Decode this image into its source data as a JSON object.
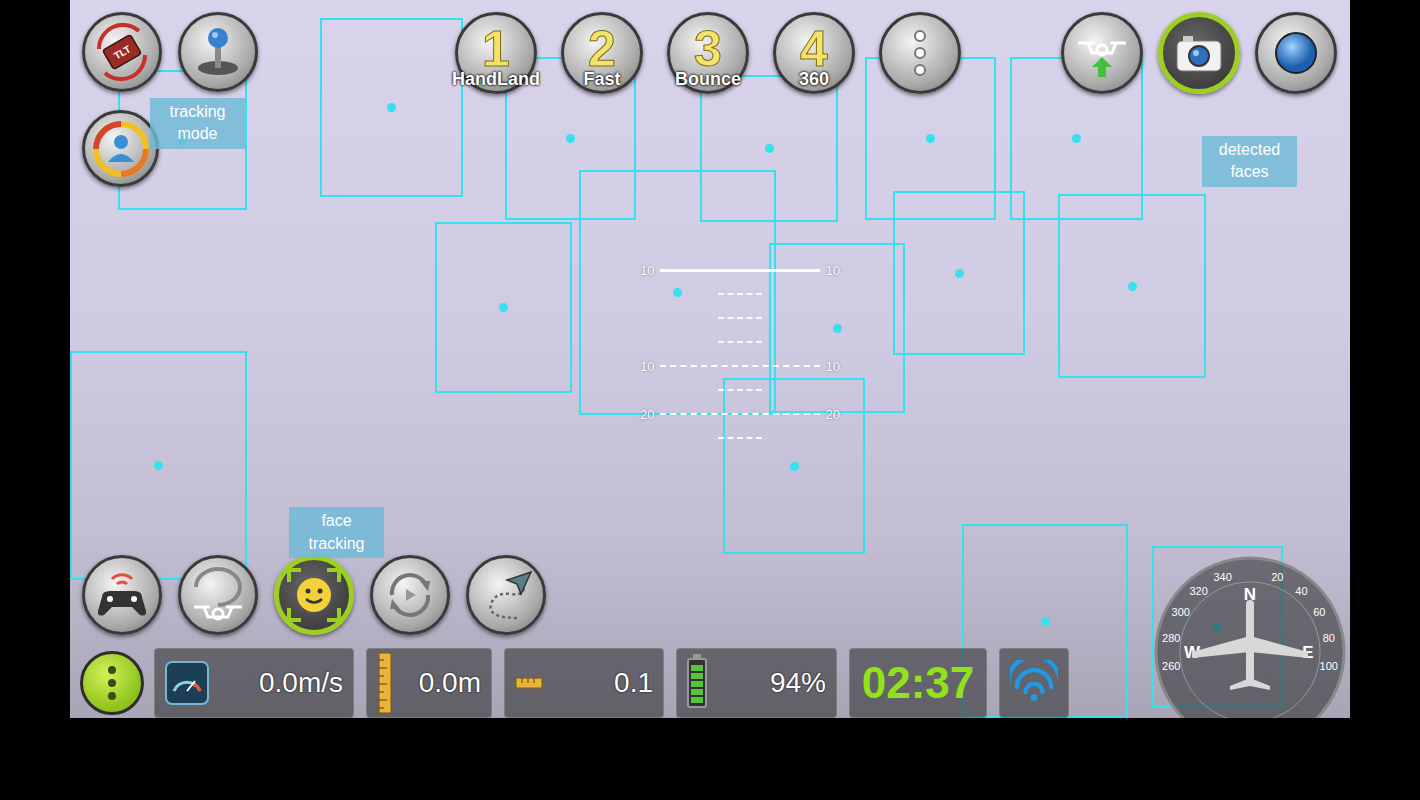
{
  "tilt_button": {
    "label": "TLT",
    "selected": false
  },
  "joystick_button": {
    "selected": false
  },
  "tracking_mode_button": {
    "selected": false
  },
  "callouts": [
    {
      "kind": "tracking-mode",
      "text": "tracking mode"
    },
    {
      "kind": "detected-faces",
      "text": "detected faces"
    },
    {
      "kind": "face-tracking",
      "text": "face tracking"
    }
  ],
  "flip_buttons": [
    {
      "number": "1",
      "label": "HandLand"
    },
    {
      "number": "2",
      "label": "Fast"
    },
    {
      "number": "3",
      "label": "Bounce"
    },
    {
      "number": "4",
      "label": "360"
    }
  ],
  "right_buttons": [
    {
      "kind": "takeoff",
      "selected": false
    },
    {
      "kind": "camera",
      "selected": true
    },
    {
      "kind": "record",
      "selected": false
    }
  ],
  "controls": [
    {
      "kind": "gamepad",
      "selected": false
    },
    {
      "kind": "land",
      "selected": false
    },
    {
      "kind": "face-tracking",
      "selected": true
    },
    {
      "kind": "rotate",
      "selected": false
    },
    {
      "kind": "path",
      "selected": false
    }
  ],
  "hud": [
    {
      "kind": "solid",
      "left": "10",
      "right": "10"
    },
    {
      "kind": "dashed",
      "left": "10",
      "right": "10"
    },
    {
      "kind": "dashed",
      "left": "20",
      "right": "20"
    }
  ],
  "status_bar": {
    "menu_selected": true,
    "speed": "0.0m/s",
    "distance": "0.0m",
    "altitude": "0.1",
    "battery": {
      "reading": "94%",
      "level": 0.94
    },
    "time": "02:37",
    "wifi": {
      "level": 1
    }
  },
  "compass": {
    "labels": [
      "260",
      "W",
      "280",
      "300",
      "320",
      "340",
      "N",
      "20",
      "40",
      "60",
      "80",
      "E",
      "100"
    ]
  }
}
